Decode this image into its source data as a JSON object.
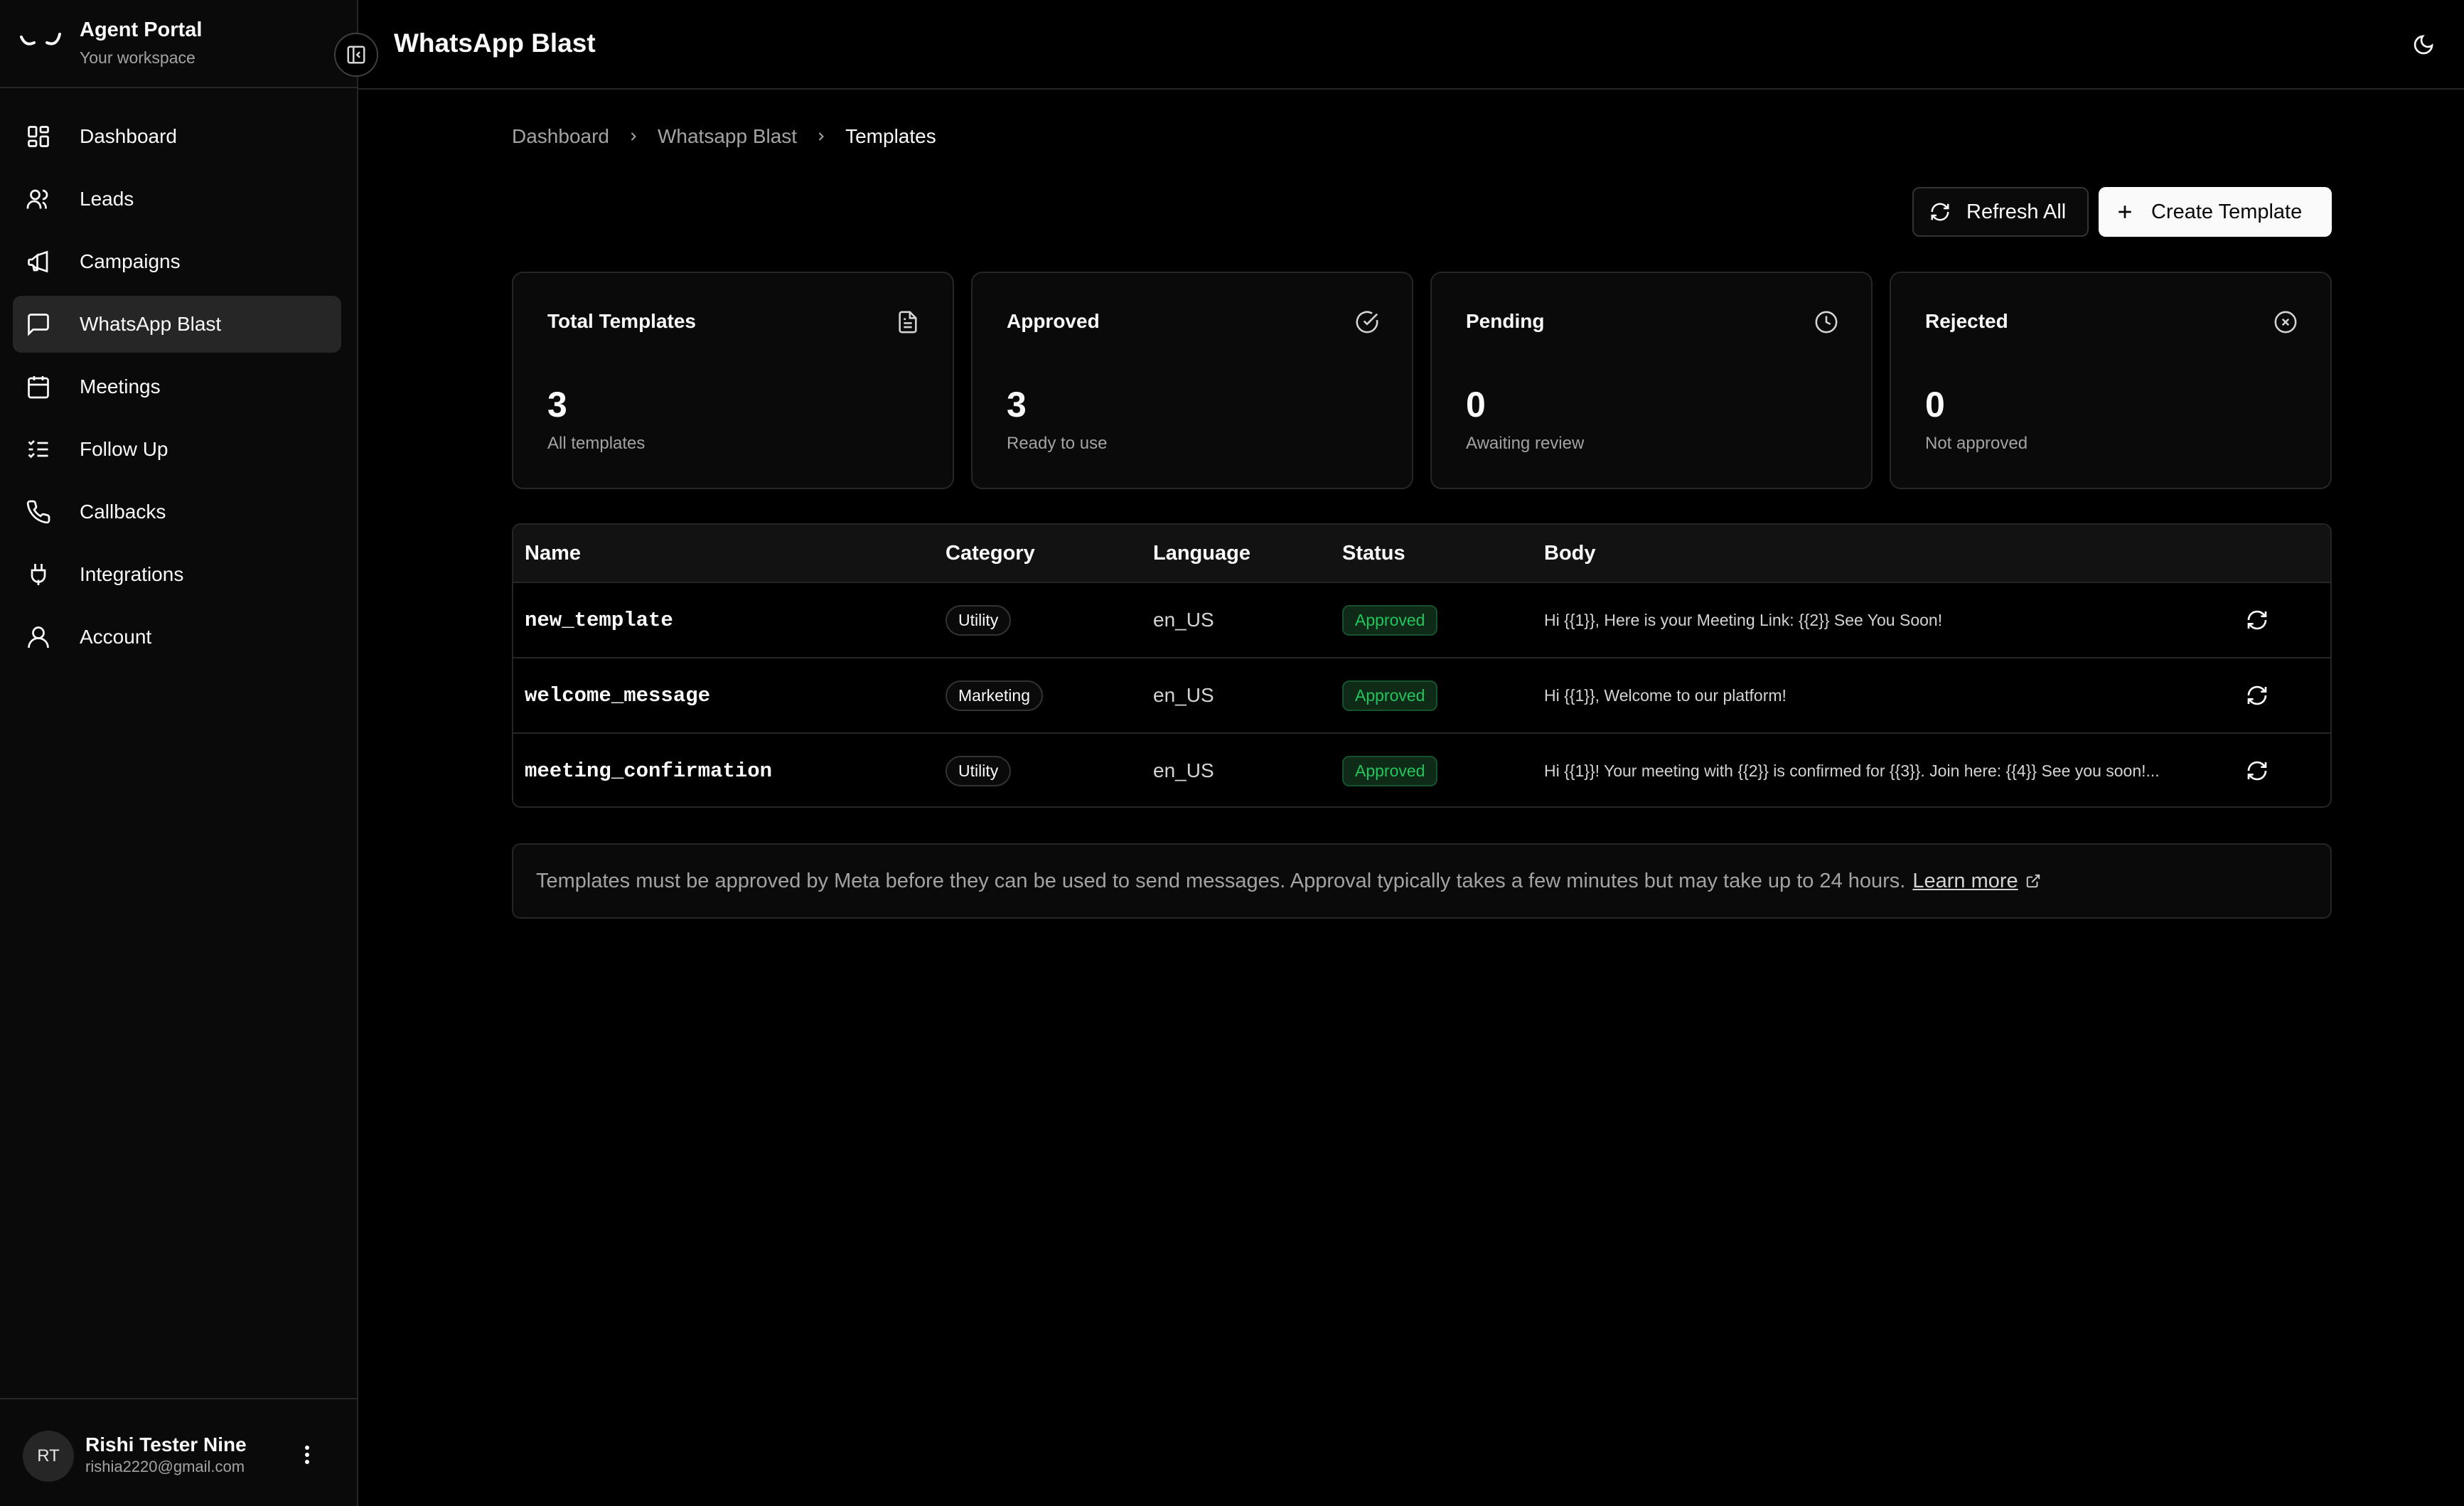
{
  "sidebar": {
    "brand_title": "Agent Portal",
    "brand_subtitle": "Your workspace",
    "items": [
      {
        "label": "Dashboard",
        "icon": "dashboard-icon",
        "active": false
      },
      {
        "label": "Leads",
        "icon": "users-icon",
        "active": false
      },
      {
        "label": "Campaigns",
        "icon": "megaphone-icon",
        "active": false
      },
      {
        "label": "WhatsApp Blast",
        "icon": "message-square-icon",
        "active": true
      },
      {
        "label": "Meetings",
        "icon": "calendar-icon",
        "active": false
      },
      {
        "label": "Follow Up",
        "icon": "list-checks-icon",
        "active": false
      },
      {
        "label": "Callbacks",
        "icon": "phone-icon",
        "active": false
      },
      {
        "label": "Integrations",
        "icon": "plug-icon",
        "active": false
      },
      {
        "label": "Account",
        "icon": "user-icon",
        "active": false
      }
    ],
    "user": {
      "initials": "RT",
      "name": "Rishi Tester Nine",
      "email": "rishia2220@gmail.com"
    }
  },
  "header": {
    "title": "WhatsApp Blast"
  },
  "breadcrumb": [
    "Dashboard",
    "Whatsapp Blast",
    "Templates"
  ],
  "actions": {
    "refresh_label": "Refresh All",
    "create_label": "Create Template"
  },
  "stats": [
    {
      "title": "Total Templates",
      "value": "3",
      "desc": "All templates",
      "icon": "file-text-icon"
    },
    {
      "title": "Approved",
      "value": "3",
      "desc": "Ready to use",
      "icon": "check-circle-icon"
    },
    {
      "title": "Pending",
      "value": "0",
      "desc": "Awaiting review",
      "icon": "clock-icon"
    },
    {
      "title": "Rejected",
      "value": "0",
      "desc": "Not approved",
      "icon": "x-circle-icon"
    }
  ],
  "table": {
    "columns": [
      "Name",
      "Category",
      "Language",
      "Status",
      "Body"
    ],
    "rows": [
      {
        "name": "new_template",
        "category": "Utility",
        "language": "en_US",
        "status": "Approved",
        "body": "Hi {{1}}, Here is your Meeting Link: {{2}} See You Soon!"
      },
      {
        "name": "welcome_message",
        "category": "Marketing",
        "language": "en_US",
        "status": "Approved",
        "body": "Hi {{1}}, Welcome to our platform!"
      },
      {
        "name": "meeting_confirmation",
        "category": "Utility",
        "language": "en_US",
        "status": "Approved",
        "body": "Hi {{1}}! Your meeting with {{2}} is confirmed for {{3}}. Join here: {{4}} See you soon!..."
      }
    ]
  },
  "notice": {
    "text": "Templates must be approved by Meta before they can be used to send messages. Approval typically takes a few minutes but may take up to 24 hours.",
    "link": "Learn more"
  },
  "colors": {
    "background": "#000000",
    "sidebar": "#0a0a0a",
    "active_nav": "#262626",
    "approved": "#22c55e"
  }
}
